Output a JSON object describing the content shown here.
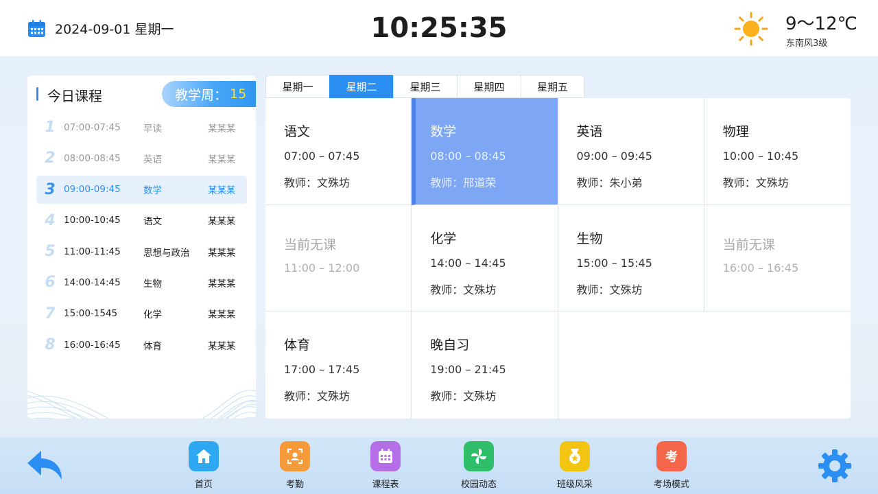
{
  "header": {
    "date": "2024-09-01  星期一",
    "clock": "10:25:35",
    "temperature": "9～12℃",
    "wind": "东南风3级",
    "weather_icon": "sun-icon"
  },
  "today": {
    "title": "今日课程",
    "week_label": "教学周：",
    "week_number": "15",
    "lessons": [
      {
        "num": "1",
        "time": "07:00-07:45",
        "subject": "早读",
        "teacher": "某某某",
        "state": "done"
      },
      {
        "num": "2",
        "time": "08:00-08:45",
        "subject": "英语",
        "teacher": "某某某",
        "state": "done"
      },
      {
        "num": "3",
        "time": "09:00-09:45",
        "subject": "数学",
        "teacher": "某某某",
        "state": "current"
      },
      {
        "num": "4",
        "time": "10:00-10:45",
        "subject": "语文",
        "teacher": "某某某",
        "state": "upcoming"
      },
      {
        "num": "5",
        "time": "11:00-11:45",
        "subject": "思想与政治",
        "teacher": "某某某",
        "state": "upcoming"
      },
      {
        "num": "6",
        "time": "14:00-14:45",
        "subject": "生物",
        "teacher": "某某某",
        "state": "upcoming"
      },
      {
        "num": "7",
        "time": "15:00-1545",
        "subject": "化学",
        "teacher": "某某某",
        "state": "upcoming"
      },
      {
        "num": "8",
        "time": "16:00-16:45",
        "subject": "体育",
        "teacher": "某某某",
        "state": "upcoming"
      }
    ]
  },
  "tabs": [
    {
      "label": "星期一",
      "active": false
    },
    {
      "label": "星期二",
      "active": true
    },
    {
      "label": "星期三",
      "active": false
    },
    {
      "label": "星期四",
      "active": false
    },
    {
      "label": "星期五",
      "active": false
    }
  ],
  "schedule": [
    {
      "subject": "语文",
      "time": "07:00 – 07:45",
      "teacher": "教师：文殊坊",
      "type": "normal"
    },
    {
      "subject": "数学",
      "time": "08:00 – 08:45",
      "teacher": "教师：邢道荣",
      "type": "active"
    },
    {
      "subject": "英语",
      "time": "09:00 – 09:45",
      "teacher": "教师：朱小弟",
      "type": "normal"
    },
    {
      "subject": "物理",
      "time": "10:00 – 10:45",
      "teacher": "教师：文殊坊",
      "type": "normal"
    },
    {
      "subject": "当前无课",
      "time": "11:00 – 12:00",
      "teacher": "",
      "type": "empty"
    },
    {
      "subject": "化学",
      "time": "14:00 – 14:45",
      "teacher": "教师：文殊坊",
      "type": "normal"
    },
    {
      "subject": "生物",
      "time": "15:00 – 15:45",
      "teacher": "教师：文殊坊",
      "type": "normal"
    },
    {
      "subject": "当前无课",
      "time": "16:00 – 16:45",
      "teacher": "",
      "type": "empty"
    },
    {
      "subject": "体育",
      "time": "17:00 – 17:45",
      "teacher": "教师：文殊坊",
      "type": "normal"
    },
    {
      "subject": "晚自习",
      "time": "19:00 – 21:45",
      "teacher": "教师：文殊坊",
      "type": "normal"
    }
  ],
  "nav": {
    "items": [
      {
        "label": "首页",
        "icon": "home-icon",
        "color": "#2fa8f4"
      },
      {
        "label": "考勤",
        "icon": "attendance-icon",
        "color": "#f79a3a"
      },
      {
        "label": "课程表",
        "icon": "calendar-icon",
        "color": "#b56ee8"
      },
      {
        "label": "校园动态",
        "icon": "pinwheel-icon",
        "color": "#2fbf6a"
      },
      {
        "label": "班级风采",
        "icon": "medal-icon",
        "color": "#f2c513"
      },
      {
        "label": "考场模式",
        "icon": "exam-icon",
        "color": "#f4664a"
      }
    ],
    "back_icon": "back-arrow-icon",
    "settings_icon": "gear-icon"
  },
  "colors": {
    "accent": "#2b8ef2",
    "active_cell": "#7da6f4",
    "week_number": "#ffe033"
  }
}
